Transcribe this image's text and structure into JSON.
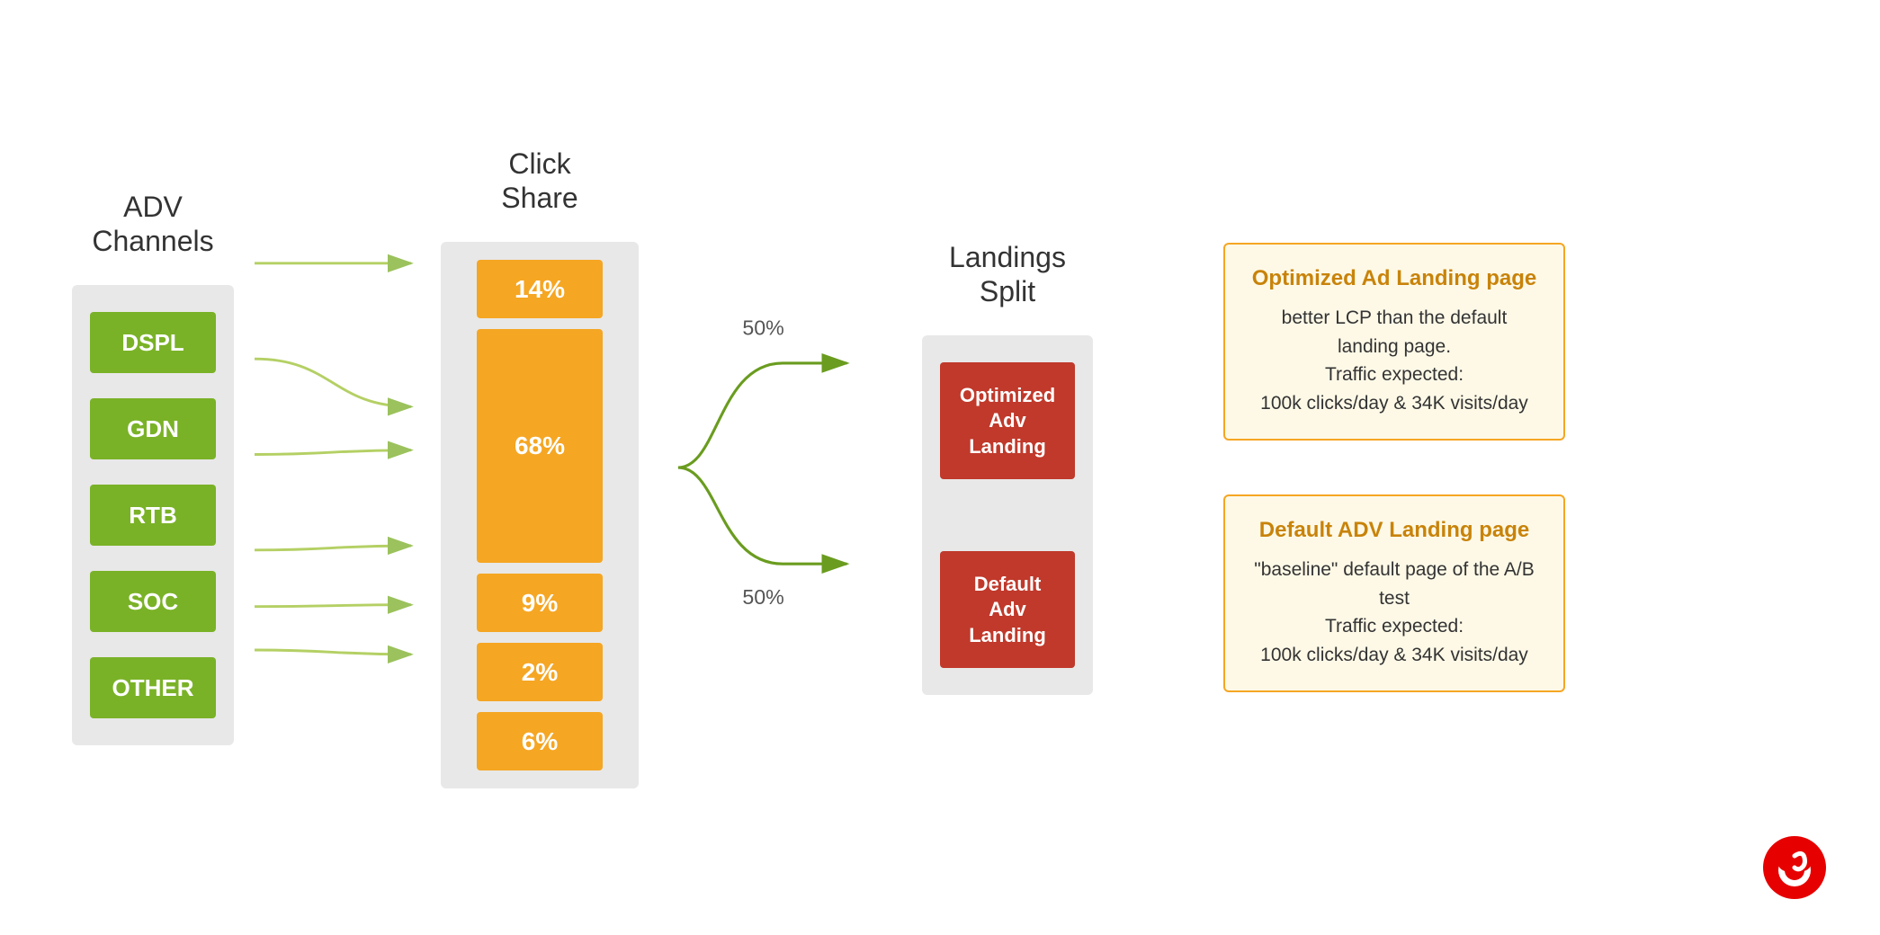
{
  "headers": {
    "adv": "ADV\nChannels",
    "click": "Click\nShare",
    "landings": "Landings\nSplit"
  },
  "adv_channels": [
    {
      "label": "DSPL"
    },
    {
      "label": "GDN"
    },
    {
      "label": "RTB"
    },
    {
      "label": "SOC"
    },
    {
      "label": "OTHER"
    }
  ],
  "click_shares": [
    {
      "value": "14%",
      "size": "small"
    },
    {
      "value": "68%",
      "size": "large"
    },
    {
      "value": "9%",
      "size": "small"
    },
    {
      "value": "2%",
      "size": "small"
    },
    {
      "value": "6%",
      "size": "small"
    }
  ],
  "split_percentages": [
    "50%",
    "50%"
  ],
  "landings": [
    {
      "label": "Optimized\nAdv\nLanding"
    },
    {
      "label": "Default\nAdv\nLanding"
    }
  ],
  "info_boxes": [
    {
      "title": "Optimized Ad Landing page",
      "text": "better LCP than the default landing page.\nTraffic expected:\n100k clicks/day  & 34K visits/day"
    },
    {
      "title": "Default ADV Landing page",
      "text": "\"baseline\" default page of the A/B test\nTraffic expected:\n100k clicks/day  & 34K visits/day"
    }
  ]
}
